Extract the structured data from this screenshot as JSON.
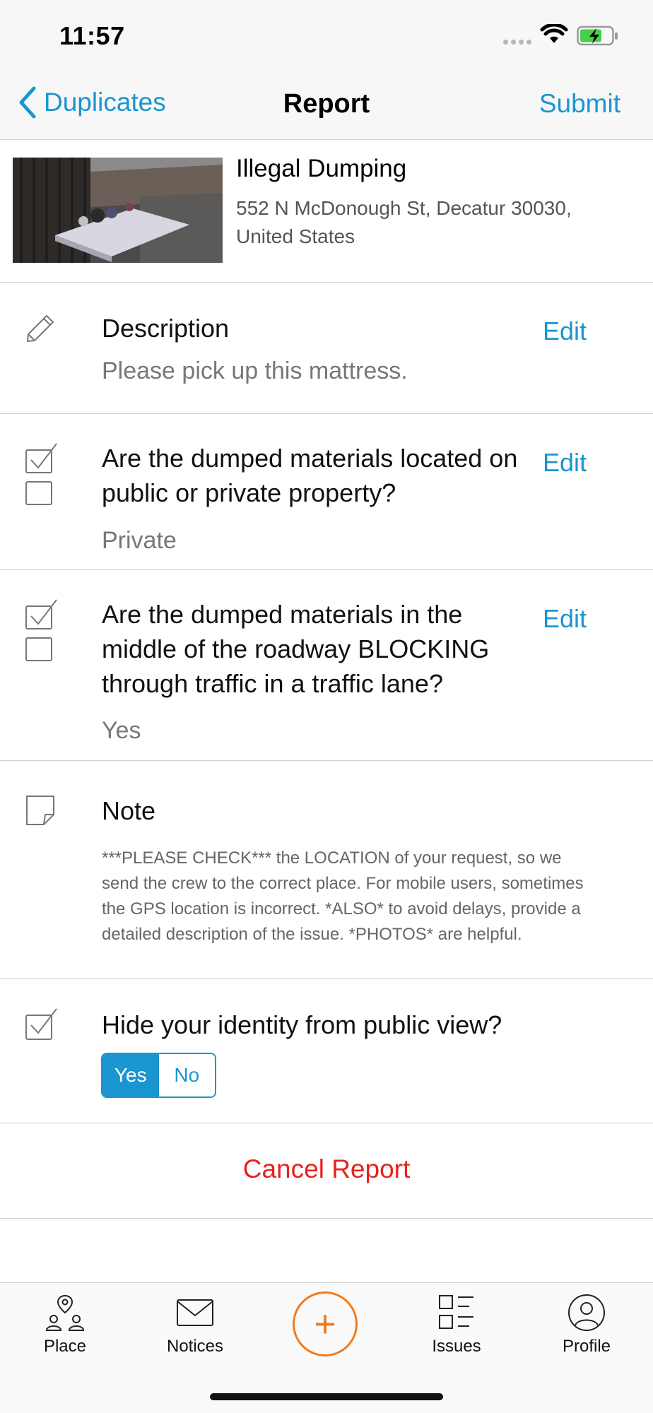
{
  "status_bar": {
    "time": "11:57"
  },
  "nav": {
    "back_label": "Duplicates",
    "title": "Report",
    "submit_label": "Submit"
  },
  "header": {
    "issue_type": "Illegal Dumping",
    "address": "552 N McDonough St, Decatur 30030, United States"
  },
  "sections": {
    "description": {
      "title": "Description",
      "edit": "Edit",
      "value": "Please pick up this mattress."
    },
    "question1": {
      "title": "Are the dumped materials located on public or private property?",
      "edit": "Edit",
      "value": "Private"
    },
    "question2": {
      "title": "Are the dumped materials in the middle of the roadway BLOCKING through traffic in a traffic lane?",
      "edit": "Edit",
      "value": "Yes"
    },
    "note": {
      "title": "Note",
      "text": "***PLEASE CHECK*** the LOCATION of your request, so we send the crew to the correct place. For mobile users, sometimes the GPS location is incorrect. *ALSO* to avoid delays, provide a detailed description of the issue. *PHOTOS* are helpful."
    },
    "identity": {
      "title": "Hide your identity from public view?",
      "yes": "Yes",
      "no": "No",
      "selected": "Yes"
    }
  },
  "cancel_label": "Cancel Report",
  "tabs": [
    {
      "label": "Place",
      "icon": "place-icon"
    },
    {
      "label": "Notices",
      "icon": "envelope-icon"
    },
    {
      "label": "+",
      "icon": "plus-icon"
    },
    {
      "label": "Issues",
      "icon": "list-icon"
    },
    {
      "label": "Profile",
      "icon": "profile-icon"
    }
  ],
  "colors": {
    "accent": "#1a95d0",
    "danger": "#e8211e",
    "fab": "#f07b1c"
  }
}
